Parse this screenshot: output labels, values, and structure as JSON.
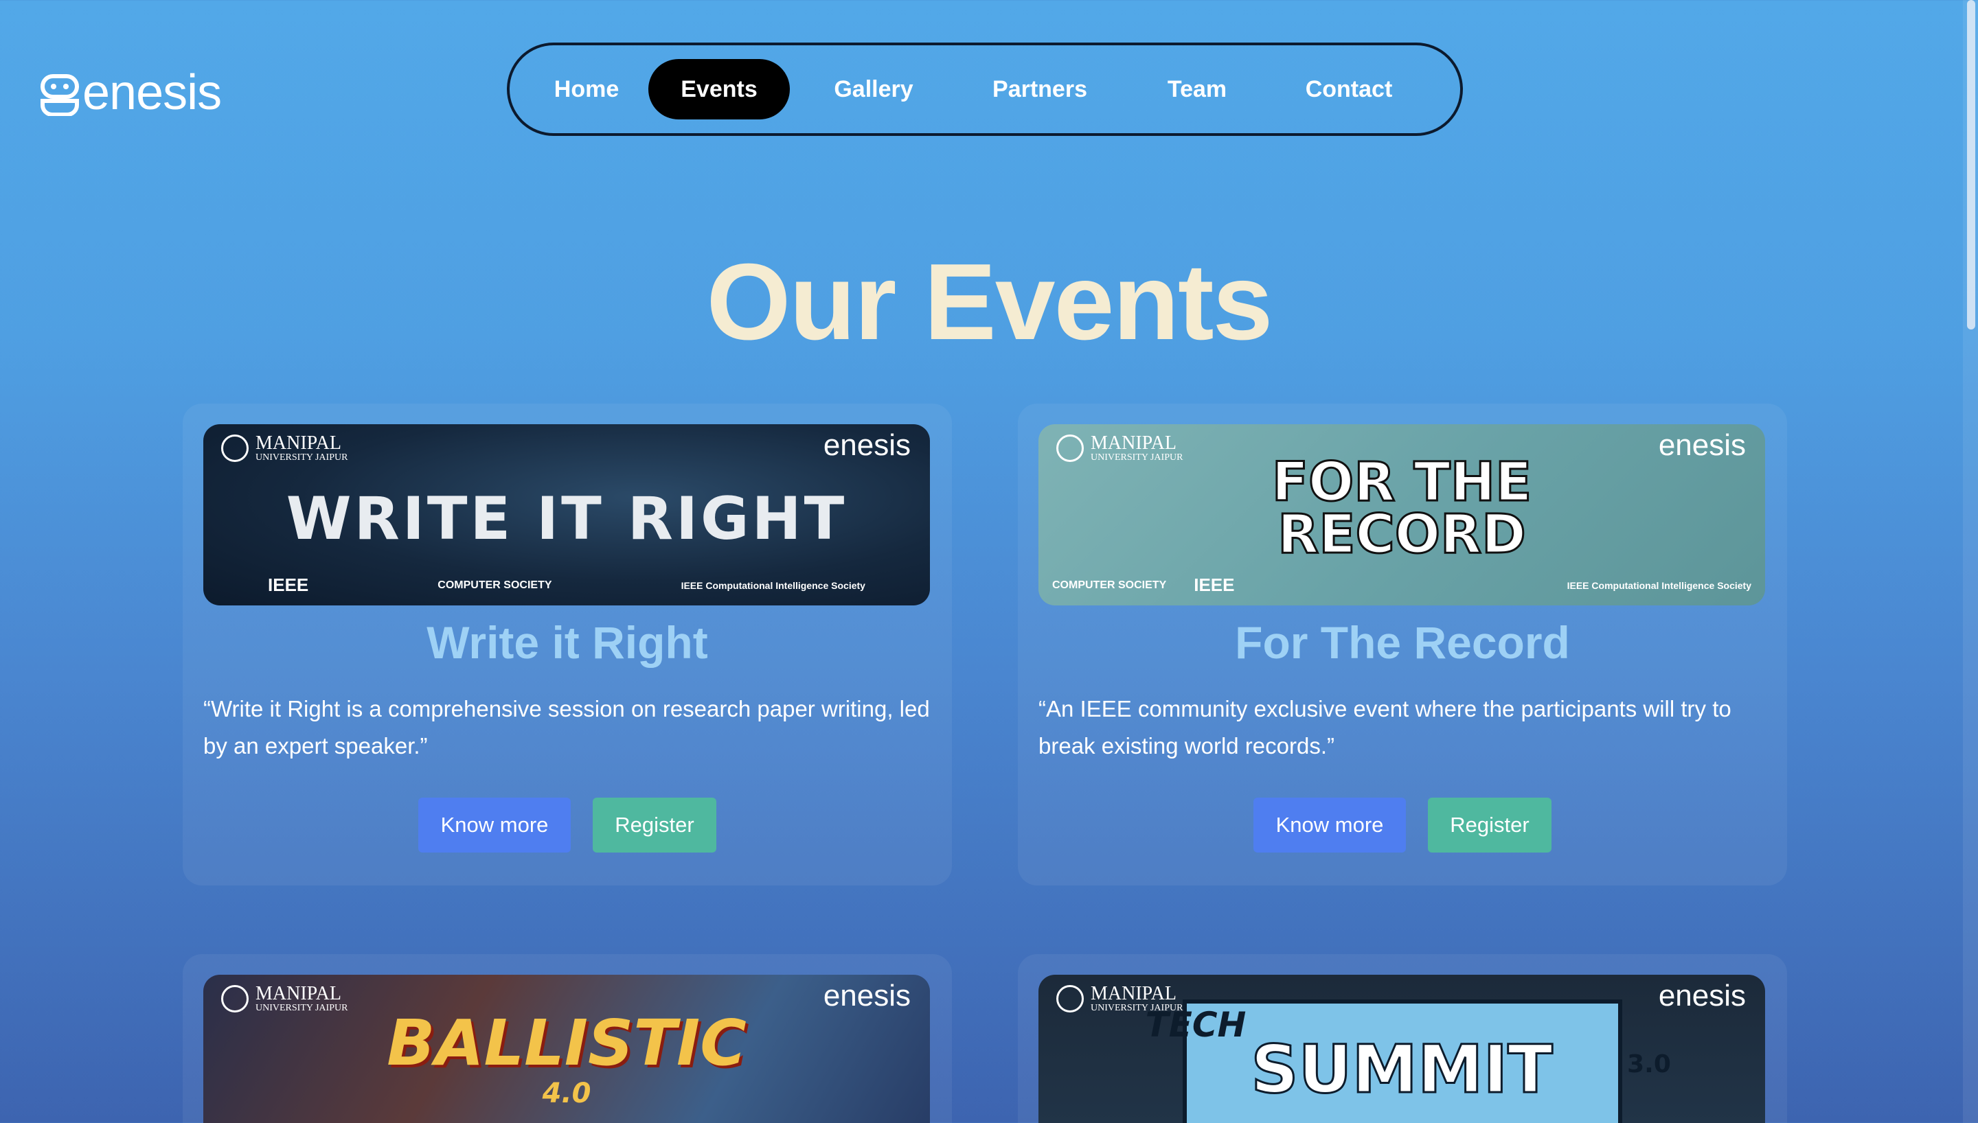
{
  "header": {
    "logo_text": "enesis"
  },
  "nav": {
    "items": [
      {
        "label": "Home",
        "active": false
      },
      {
        "label": "Events",
        "active": true
      },
      {
        "label": "Gallery",
        "active": false
      },
      {
        "label": "Partners",
        "active": false
      },
      {
        "label": "Team",
        "active": false
      },
      {
        "label": "Contact",
        "active": false
      }
    ]
  },
  "page": {
    "title": "Our Events"
  },
  "events": [
    {
      "title": "Write it Right",
      "description": "“Write it Right is a comprehensive session on research paper writing, led by an expert speaker.”",
      "know_more": "Know more",
      "register": "Register",
      "banner": {
        "university": "MANIPAL",
        "university_sub": "UNIVERSITY JAIPUR",
        "brand": "enesis",
        "headline": "WRITE IT RIGHT",
        "sponsors": [
          "IEEE",
          "COMPUTER SOCIETY",
          "IEEE Computational Intelligence Society"
        ]
      }
    },
    {
      "title": "For The Record",
      "description": "“An IEEE community exclusive event where the participants will try to break existing world records.”",
      "know_more": "Know more",
      "register": "Register",
      "banner": {
        "university": "MANIPAL",
        "university_sub": "UNIVERSITY JAIPUR",
        "brand": "enesis",
        "headline_line1": "FOR THE",
        "headline_line2": "RECORD",
        "sponsors": [
          "COMPUTER SOCIETY",
          "IEEE",
          "IEEE Computational Intelligence Society"
        ]
      }
    },
    {
      "banner": {
        "university": "MANIPAL",
        "university_sub": "UNIVERSITY JAIPUR",
        "brand": "enesis",
        "headline": "BALLISTIC",
        "headline_sub": "4.0"
      }
    },
    {
      "banner": {
        "university": "MANIPAL",
        "university_sub": "UNIVERSITY JAIPUR",
        "brand": "enesis",
        "headline_top": "TECH",
        "headline": "SUMMIT",
        "headline_sub": "3.0"
      }
    }
  ],
  "colors": {
    "title_cream": "#f5ecd2",
    "card_title": "#9ed1f5",
    "know_more_btn": "#4f7ef0",
    "register_btn": "#4fb89f",
    "nav_active": "#000000"
  }
}
